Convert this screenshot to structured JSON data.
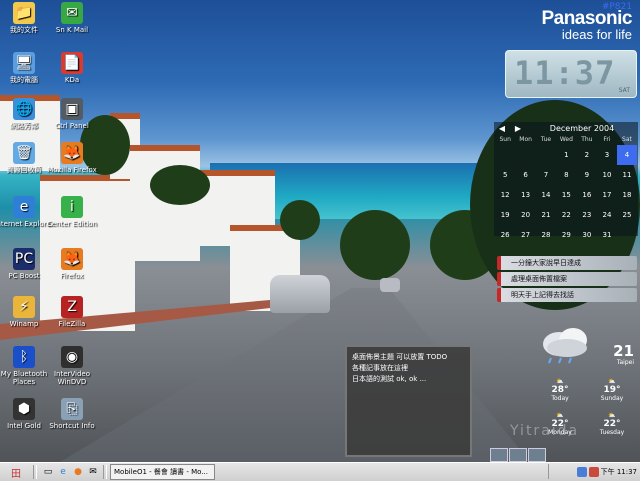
{
  "desktop_icons": [
    {
      "label": "我的文件",
      "icon": "folder-icon",
      "color": "#f2c94c",
      "glyph": "📁"
    },
    {
      "label": "Sn K Mail",
      "icon": "mail-icon",
      "color": "#38a845",
      "glyph": "✉"
    },
    {
      "label": "我的電腦",
      "icon": "computer-icon",
      "color": "#5a9ee0",
      "glyph": "🖥"
    },
    {
      "label": "KDa",
      "icon": "pdf-icon",
      "color": "#d93b2f",
      "glyph": "📄"
    },
    {
      "label": "網路芳鄰",
      "icon": "network-icon",
      "color": "#3b8fd9",
      "glyph": "🌐"
    },
    {
      "label": "Ctrl Panel",
      "icon": "panel-icon",
      "color": "#555b62",
      "glyph": "▣"
    },
    {
      "label": "資源回收筒",
      "icon": "recycle-icon",
      "color": "#62a9e6",
      "glyph": "🗑"
    },
    {
      "label": "Mozilla Firefox",
      "icon": "firefox-icon",
      "color": "#e87a1f",
      "glyph": "🦊"
    },
    {
      "label": "Internet Explorer",
      "icon": "ie-icon",
      "color": "#2f7fd6",
      "glyph": "e"
    },
    {
      "label": "Center Edition",
      "icon": "info-icon",
      "color": "#37b14a",
      "glyph": "i"
    },
    {
      "label": "PC Boost",
      "icon": "pc-icon",
      "color": "#1b2e6b",
      "glyph": "PC"
    },
    {
      "label": "Firefox",
      "icon": "firefox-small-icon",
      "color": "#e87a1f",
      "glyph": "🦊"
    },
    {
      "label": "Winamp",
      "icon": "winamp-icon",
      "color": "#e9b53b",
      "glyph": "⚡"
    },
    {
      "label": "FileZilla",
      "icon": "filezilla-icon",
      "color": "#b72222",
      "glyph": "Z"
    },
    {
      "label": "My Bluetooth Places",
      "icon": "bluetooth-icon",
      "color": "#1b4fc9",
      "glyph": "ᛒ"
    },
    {
      "label": "InterVideo WinDVD",
      "icon": "dvd-icon",
      "color": "#2f2f2f",
      "glyph": "◉"
    },
    {
      "label": "Intel Gold",
      "icon": "intel-icon",
      "color": "#333",
      "glyph": "⬢"
    },
    {
      "label": "Shortcut Info",
      "icon": "shortcut-icon",
      "color": "#8aa0b5",
      "glyph": "⎘"
    }
  ],
  "brand": {
    "tag": "#P821",
    "name": "Panasonic",
    "slogan": "ideas for life"
  },
  "clock": {
    "time": "11:37",
    "day": "SAT"
  },
  "calendar": {
    "month_label": "December 2004",
    "prev": "◀",
    "next": "▶",
    "weekdays": [
      "Sun",
      "Mon",
      "Tue",
      "Wed",
      "Thu",
      "Fri",
      "Sat"
    ],
    "weeks": [
      [
        "",
        "",
        "",
        "1",
        "2",
        "3",
        "4"
      ],
      [
        "5",
        "6",
        "7",
        "8",
        "9",
        "10",
        "11"
      ],
      [
        "12",
        "13",
        "14",
        "15",
        "16",
        "17",
        "18"
      ],
      [
        "19",
        "20",
        "21",
        "22",
        "23",
        "24",
        "25"
      ],
      [
        "26",
        "27",
        "28",
        "29",
        "30",
        "31",
        ""
      ]
    ],
    "today": "4",
    "today_color": "#3d6cf0"
  },
  "tasks": [
    "一分鐘大家說早日達成",
    "處理桌面佈置檔案",
    "明天手上記得去找話"
  ],
  "note": {
    "lines": [
      "桌面佈景主題 可以放置 TODO",
      "各種記事放在這裡",
      "日本語的測試 ok, ok ..."
    ]
  },
  "weather": {
    "temp": "21",
    "city": "Taipei",
    "forecast": [
      {
        "day": "Today",
        "temp": "28°"
      },
      {
        "day": "Sunday",
        "temp": "19°"
      },
      {
        "day": "Monday",
        "temp": "22°"
      },
      {
        "day": "Tuesday",
        "temp": "22°"
      }
    ],
    "watermark": "Yitraida"
  },
  "taskbar": {
    "start_glyph": "田",
    "quick_launch": [
      "desktop-icon",
      "ie-icon",
      "firefox-icon",
      "mail-icon"
    ],
    "window_button": "MobileO1 - 餐會 讀書 - Mo...",
    "clock": "下午 11:37"
  }
}
